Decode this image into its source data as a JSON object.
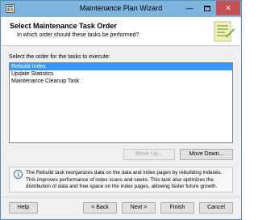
{
  "window": {
    "title": "Maintenance Plan Wizard",
    "minimize_glyph": "—",
    "close_glyph": "✕"
  },
  "header": {
    "heading": "Select Maintenance Task Order",
    "subheading": "In which order should these tasks be performed?"
  },
  "task_list": {
    "label": "Select the order for the tasks to execute:",
    "items": [
      {
        "label": "Rebuild Index",
        "selected": true
      },
      {
        "label": "Update Statistics",
        "selected": false
      },
      {
        "label": "Maintenance Cleanup Task",
        "selected": false
      }
    ]
  },
  "buttons": {
    "move_up": "Move Up...",
    "move_down": "Move Down...",
    "help": "Help",
    "back": "< Back",
    "next": "Next >",
    "finish": "Finish",
    "cancel": "Cancel"
  },
  "info": {
    "text": "The Rebuild task reorganizes data on the data and index pages by rebuilding indexes. This improves performance of index scans and seeks. This task also optimizes the distribution of data and free space on the index pages, allowing faster future growth."
  },
  "colors": {
    "titlebar": "#7eb4dd",
    "close_button": "#c75050",
    "selection": "#3399ff",
    "dialog_background": "#f0f0f0"
  },
  "icons": [
    "app-icon",
    "minimize-icon",
    "maximize-icon",
    "close-icon",
    "wizard-banner-icon",
    "info-icon"
  ]
}
